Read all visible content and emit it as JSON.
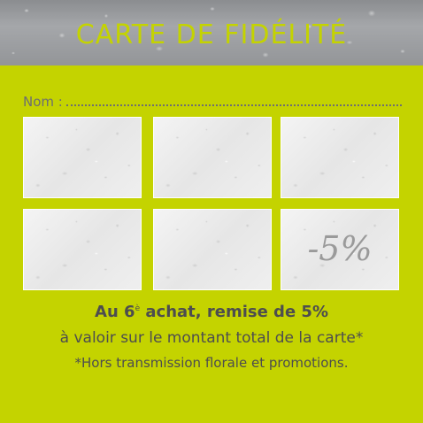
{
  "header": {
    "title": "CARTE DE FIDÉLITÉ"
  },
  "form": {
    "name_label": "Nom :"
  },
  "stamps": {
    "last_box_label": "-5%"
  },
  "offer": {
    "line1_before": "Au 6",
    "line1_superscript": "è",
    "line1_after": " achat, remise de 5%",
    "line2": "à valoir sur le montant total de la carte*",
    "line3": "*Hors transmission florale et promotions."
  },
  "colors": {
    "background": "#c4d300",
    "header_texture": "#939598",
    "text": "#4d4d4f"
  }
}
